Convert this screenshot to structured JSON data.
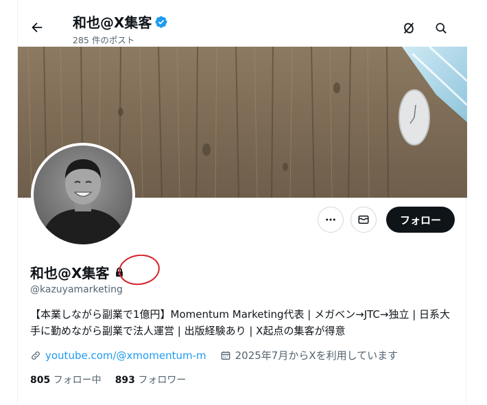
{
  "header": {
    "display_name": "和也@X集客",
    "post_count": "285 件のポスト"
  },
  "profile": {
    "display_name": "和也@X集客",
    "handle": "@kazuyamarketing",
    "bio": "【本業しながら副業で1億円】Momentum Marketing代表 | メガベン→JTC→独立 | 日系大手に勤めながら副業で法人運営 | 出版経験あり | X起点の集客が得意",
    "website": "youtube.com/@xmomentum-m",
    "joined": "2025年7月からXを利用しています",
    "following_count": "805",
    "following_label": "フォロー中",
    "followers_count": "893",
    "followers_label": "フォロワー"
  },
  "actions": {
    "follow_label": "フォロー"
  },
  "icons": {
    "back": "arrow-left-icon",
    "verified": "verified-badge-icon",
    "grok": "grok-icon",
    "search": "search-icon",
    "more": "more-icon",
    "message": "mail-icon",
    "lock": "lock-icon",
    "link": "link-icon",
    "calendar": "calendar-icon"
  },
  "colors": {
    "accent": "#1d9bf0",
    "text": "#0f1419",
    "secondary": "#536471",
    "follow_bg": "#0f1419",
    "highlight": "#d6202a"
  }
}
